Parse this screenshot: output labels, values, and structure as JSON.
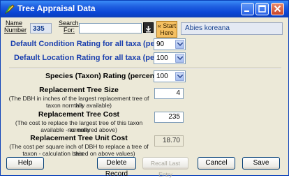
{
  "window": {
    "title": "Tree Appraisal Data"
  },
  "header": {
    "name_number_label_1": "Name",
    "name_number_label_2": "Number",
    "name_number_value": "335",
    "search_label_1": "Search",
    "search_label_2": "For:",
    "search_value": "",
    "start_button_line1": "« Start",
    "start_button_line2": "Here",
    "taxon_name": "Abies koreana"
  },
  "ratings": {
    "condition_label": "Default Condition Rating for all taxa (percent)",
    "condition_value": "90",
    "location_label": "Default Location Rating for all taxa (percent)",
    "location_value": "100",
    "species_label": "Species (Taxon) Rating (percent)",
    "species_value": "100"
  },
  "replacement": {
    "size_label": "Replacement Tree Size",
    "size_desc_1": "(The DBH in inches of the largest replacement tree of this",
    "size_desc_2": "taxon normally available)",
    "size_value": "4",
    "cost_label": "Replacement Tree Cost",
    "cost_desc_1": "(The cost to replace the largest tree of this taxon normally",
    "cost_desc_2": "available - as entered above)",
    "cost_value": "235",
    "unit_label": "Replacement Tree Unit Cost",
    "unit_desc_1": "(The cost per square inch of DBH to replace a tree of this",
    "unit_desc_2": "taxon - calculation based on above values)",
    "unit_value": "18.70"
  },
  "buttons": {
    "help": "Help",
    "delete": "Delete Record",
    "recall": "Recall Last Entry",
    "cancel": "Cancel",
    "save": "Save"
  }
}
